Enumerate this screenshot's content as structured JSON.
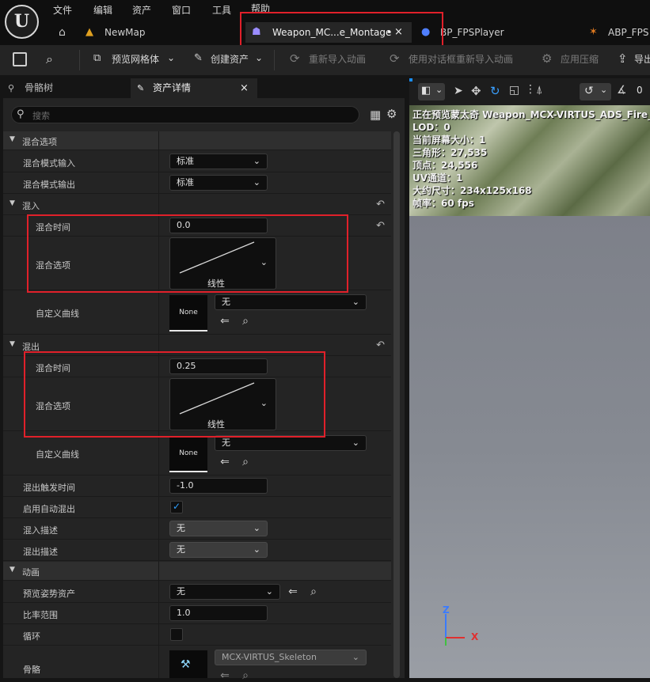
{
  "menu": [
    "文件",
    "编辑",
    "资产",
    "窗口",
    "工具",
    "帮助"
  ],
  "doc_tabs": [
    {
      "label": "NewMap",
      "icon": "map-icon"
    },
    {
      "label": "Weapon_MC...e_Montage",
      "modified": "•",
      "close": "×",
      "icon": "montage-icon"
    },
    {
      "label": "BP_FPSPlayer",
      "icon": "blueprint-icon"
    },
    {
      "label": "ABP_FPS",
      "icon": "anim-blueprint-icon"
    }
  ],
  "toolbar": {
    "preview_mesh": "预览网格体",
    "create_asset": "创建资产",
    "reimport": "重新导入动画",
    "reimport_dialog": "使用对话框重新导入动画",
    "apply_compression": "应用压缩",
    "export": "导出"
  },
  "panel_tabs": {
    "skeleton_tree": "骨骼树",
    "asset_details": "资产详情",
    "close": "×"
  },
  "search": {
    "placeholder": "搜索"
  },
  "details": {
    "cat_blend_options": "混合选项",
    "blend_mode_in": "混合模式输入",
    "blend_mode_in_value": "标准",
    "blend_mode_out": "混合模式输出",
    "blend_mode_out_value": "标准",
    "cat_blend_in": "混入",
    "blend_in_time_label": "混合时间",
    "blend_in_time": "0.0",
    "blend_in_option_label": "混合选项",
    "blend_in_curve_type": "线性",
    "blend_in_custom_curve_label": "自定义曲线",
    "blend_in_custom_curve": "无",
    "blend_in_thumb": "None",
    "cat_blend_out": "混出",
    "blend_out_time_label": "混合时间",
    "blend_out_time": "0.25",
    "blend_out_option_label": "混合选项",
    "blend_out_curve_type": "线性",
    "blend_out_custom_curve_label": "自定义曲线",
    "blend_out_custom_curve": "无",
    "blend_out_thumb": "None",
    "blend_out_trigger_label": "混出触发时间",
    "blend_out_trigger": "-1.0",
    "auto_blend_out_label": "启用自动混出",
    "auto_blend_out": true,
    "blend_in_desc_label": "混入描述",
    "blend_in_desc": "无",
    "blend_out_desc_label": "混出描述",
    "blend_out_desc": "无",
    "cat_animation": "动画",
    "preview_pose_label": "预览姿势资产",
    "preview_pose": "无",
    "rate_scale_label": "比率范围",
    "rate_scale": "1.0",
    "loop_label": "循环",
    "loop": false,
    "skeleton_label": "骨骼",
    "skeleton": "MCX-VIRTUS_Skeleton"
  },
  "viewport": {
    "stats": [
      "正在预览蒙太奇 Weapon_MCX-VIRTUS_ADS_Fire_M",
      "LOD：0",
      "当前屏幕大小：1",
      "三角形：27,535",
      "顶点：24,556",
      "UV通道：1",
      "大约尺寸：234x125x168",
      "帧率：60 fps"
    ],
    "axis_z": "Z",
    "axis_x": "X",
    "rot_value": "0"
  },
  "colors": {
    "highlight_red": "#e0202a",
    "accent_blue": "#1a8fff",
    "checkbox_check": "#2ea0ff"
  }
}
